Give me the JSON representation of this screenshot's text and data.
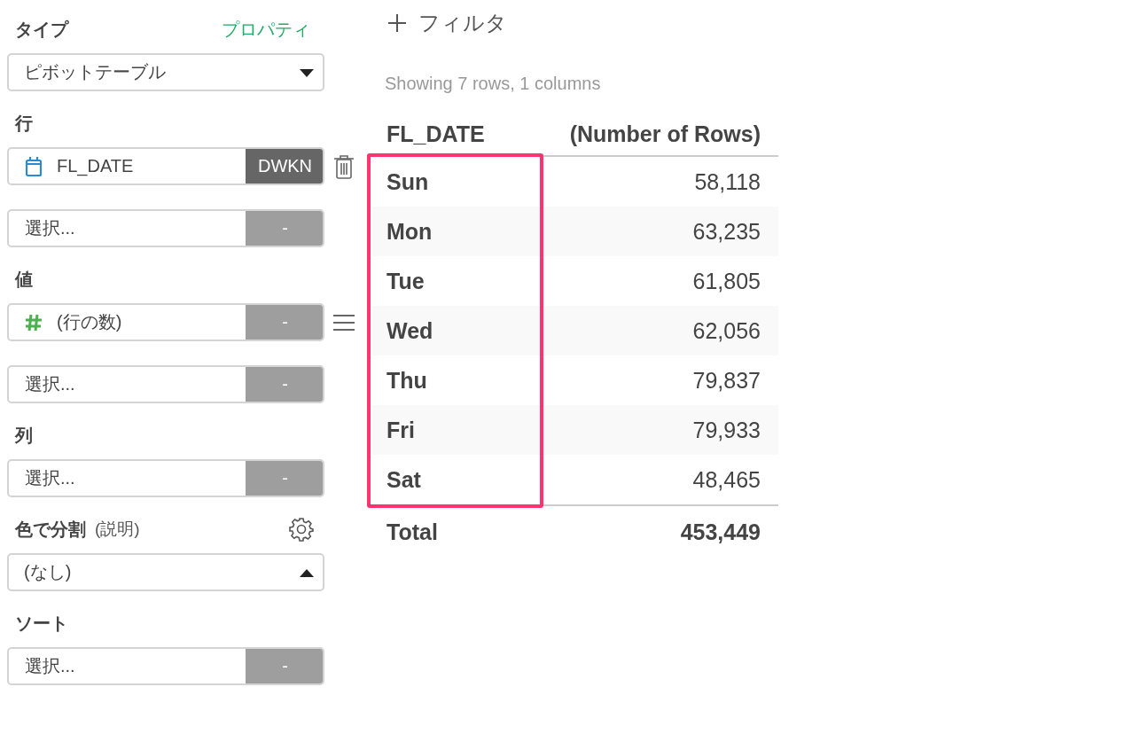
{
  "sidebar": {
    "sections": [
      {
        "title": "タイプ",
        "link": "プロパティ",
        "controls": [
          {
            "kind": "select",
            "value": "ピボットテーブル",
            "open": false
          }
        ]
      },
      {
        "title": "行",
        "controls": [
          {
            "kind": "date_field",
            "text": "FL_DATE",
            "button": "DWKN",
            "active": true
          },
          {
            "kind": "field",
            "text": "選択...",
            "button": "-",
            "active": false
          }
        ]
      },
      {
        "title": "値",
        "controls": [
          {
            "kind": "number_field",
            "text": "(行の数)",
            "button": "-",
            "active": false
          },
          {
            "kind": "field",
            "text": "選択...",
            "button": "-",
            "active": false
          }
        ]
      },
      {
        "title": "列",
        "controls": [
          {
            "kind": "field",
            "text": "選択...",
            "button": "-",
            "active": false
          }
        ]
      },
      {
        "title": "色で分割",
        "note": "(説明)",
        "gear": true,
        "controls": [
          {
            "kind": "select",
            "value": "(なし)",
            "open": true
          }
        ]
      },
      {
        "title": "ソート",
        "controls": [
          {
            "kind": "field",
            "text": "選択...",
            "button": "-",
            "active": false
          }
        ]
      }
    ]
  },
  "filter": {
    "label": "フィルタ"
  },
  "summary": "Showing 7 rows, 1 columns",
  "table": {
    "columns": [
      "FL_DATE",
      "(Number of Rows)"
    ],
    "first_column_highlighted": true,
    "rows": [
      [
        "Sun",
        "58,118"
      ],
      [
        "Mon",
        "63,235"
      ],
      [
        "Tue",
        "61,805"
      ],
      [
        "Wed",
        "62,056"
      ],
      [
        "Thu",
        "79,837"
      ],
      [
        "Fri",
        "79,933"
      ],
      [
        "Sat",
        "48,465"
      ]
    ],
    "total": [
      "Total",
      "453,449"
    ]
  }
}
